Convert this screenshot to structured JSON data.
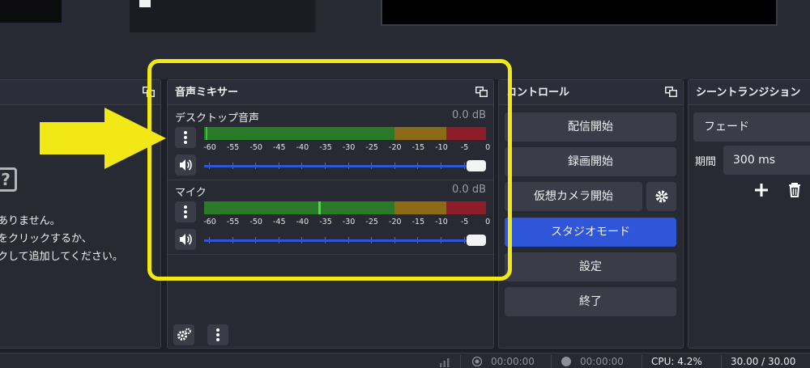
{
  "sources": {
    "empty_msg_line1": "ありません。",
    "empty_msg_line2": "をクリックするか、",
    "empty_msg_line3": "クして追加してください。"
  },
  "mixer": {
    "title": "音声ミキサー",
    "channels": [
      {
        "name": "デスクトップ音声",
        "db": "0.0 dB"
      },
      {
        "name": "マイク",
        "db": "0.0 dB"
      }
    ],
    "ticks": [
      "-60",
      "-55",
      "-50",
      "-45",
      "-40",
      "-35",
      "-30",
      "-25",
      "-20",
      "-15",
      "-10",
      "-5",
      "0"
    ]
  },
  "controls": {
    "title": "コントロール",
    "start_stream": "配信開始",
    "start_record": "録画開始",
    "virtual_cam": "仮想カメラ開始",
    "studio_mode": "スタジオモード",
    "settings": "設定",
    "exit": "終了"
  },
  "transitions": {
    "title": "シーントランジション",
    "selected": "フェード",
    "duration_label": "期間",
    "duration_value": "300 ms"
  },
  "status": {
    "stream_time": "00:00:00",
    "record_time": "00:00:00",
    "cpu": "CPU: 4.2%",
    "fps": "30.00 / 30.00"
  },
  "colors": {
    "accent": "#2f56d8",
    "highlight_frame": "#f1e815",
    "meter_green": "#2a7a2a",
    "meter_yellow": "#8d6a16",
    "meter_red": "#8d1d29"
  }
}
